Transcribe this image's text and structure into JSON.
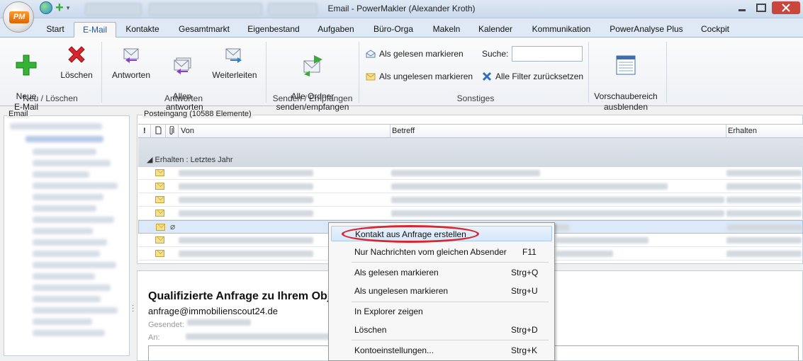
{
  "window": {
    "title": "Email - PowerMakler (Alexander Kroth)"
  },
  "app": {
    "logo_text": "PM"
  },
  "tabs": [
    "Start",
    "E-Mail",
    "Kontakte",
    "Gesamtmarkt",
    "Eigenbestand",
    "Aufgaben",
    "Büro-Orga",
    "Makeln",
    "Kalender",
    "Kommunikation",
    "PowerAnalyse Plus",
    "Cockpit"
  ],
  "active_tab": "E-Mail",
  "ribbon": {
    "new_mail": "Neue\nE-Mail",
    "delete": "Löschen",
    "group_new_delete": "Neu / Löschen",
    "reply": "Antworten",
    "reply_all": "Allen\nantworten",
    "forward": "Weiterleiten",
    "group_reply": "Antworten",
    "send_receive_all": "Alle Ordner\nsenden/empfangen",
    "group_send_receive": "Senden / Empfangen",
    "mark_read": "Als gelesen markieren",
    "mark_unread": "Als ungelesen markieren",
    "search_label": "Suche:",
    "search_value": "",
    "reset_filters": "Alle Filter zurücksetzen",
    "group_misc": "Sonstiges",
    "hide_preview": "Vorschaubereich\nausblenden"
  },
  "left_pane": {
    "label": "Email"
  },
  "inbox": {
    "label": "Posteingang (10588 Elemente)",
    "columns": {
      "importance": "!",
      "type": "",
      "attachment": "",
      "from": "Von",
      "subject": "Betreff",
      "received": "Erhalten"
    },
    "group": "Erhalten : Letztes Jahr"
  },
  "preview": {
    "subject": "Qualifizierte Anfrage zu Ihrem Obj",
    "from": "anfrage@immobilienscout24.de",
    "sent_label": "Gesendet:",
    "to_label": "An:"
  },
  "context_menu": {
    "items": [
      {
        "label": "Kontakt aus Anfrage erstellen",
        "shortcut": ""
      },
      {
        "label": "Nur Nachrichten vom gleichen Absender",
        "shortcut": "F11"
      },
      {
        "label": "Als gelesen markieren",
        "shortcut": "Strg+Q"
      },
      {
        "label": "Als ungelesen markieren",
        "shortcut": "Strg+U"
      },
      {
        "label": "In Explorer zeigen",
        "shortcut": ""
      },
      {
        "label": "Löschen",
        "shortcut": "Strg+D"
      },
      {
        "label": "Kontoeinstellungen...",
        "shortcut": "Strg+K"
      }
    ]
  },
  "colors": {
    "accent": "#1e5aa8",
    "highlight_ring": "#d9262c",
    "selection": "#dbe9f8"
  }
}
